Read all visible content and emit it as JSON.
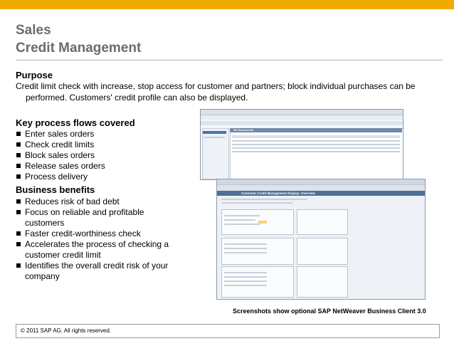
{
  "brand_color": "#f0ab00",
  "title": {
    "line1": "Sales",
    "line2": "Credit Management"
  },
  "purpose": {
    "heading": "Purpose",
    "line1": "Credit limit check with increase, stop access for customer and partners; block individual purchases can be",
    "line2": "performed. Customers' credit profile can also be displayed."
  },
  "flows": {
    "heading": "Key process flows covered",
    "items": [
      "Enter sales orders",
      "Check credit limits",
      "Block sales orders",
      "Release sales orders",
      "Process delivery"
    ]
  },
  "benefits": {
    "heading": "Business benefits",
    "items": [
      {
        "l1": "Reduces risk of bad debt",
        "l2": ""
      },
      {
        "l1": "Focus on reliable and profitable",
        "l2": "customers"
      },
      {
        "l1": "Faster credit-worthiness check",
        "l2": ""
      },
      {
        "l1": "Accelerates the process of checking a",
        "l2": "customer credit limit"
      },
      {
        "l1": "Identifies the overall credit risk of your",
        "l2": "company"
      }
    ]
  },
  "screenshots": {
    "back_title": "SD Documents",
    "front_title": "Customer Credit Management Display: Overview",
    "caption": "Screenshots show optional SAP NetWeaver Business Client 3.0"
  },
  "footer": "© 2011 SAP AG. All rights reserved."
}
